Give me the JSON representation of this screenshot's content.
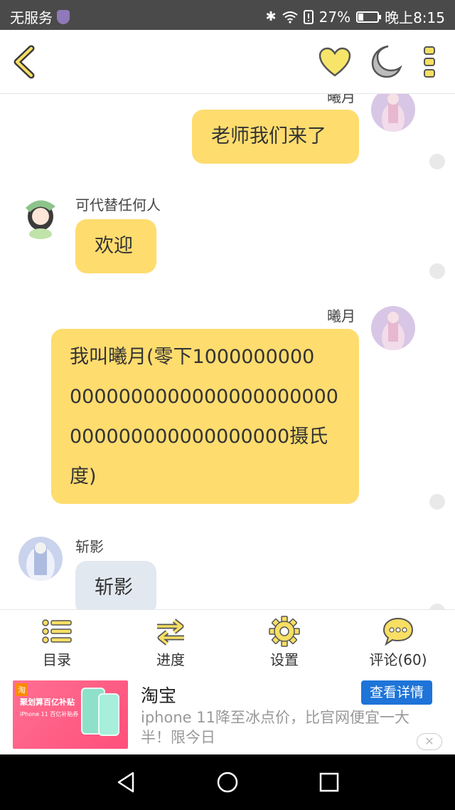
{
  "status_bar": {
    "carrier": "无服务",
    "battery": "27%",
    "battery_level": 0.27,
    "time": "晚上8:15"
  },
  "header": {
    "icons": [
      "back-icon",
      "heart-icon",
      "moon-icon",
      "more-icon"
    ],
    "accent": "#f7df63"
  },
  "messages": [
    {
      "side": "right",
      "sender": "曦月",
      "text": "老师我们来了",
      "bubble_color": "#fedc6e"
    },
    {
      "side": "left",
      "sender": "可代替任何人",
      "text": "欢迎",
      "bubble_color": "#fedc6e"
    },
    {
      "side": "right",
      "sender": "曦月",
      "lines": [
        "我叫曦月(零下1000000000",
        "0000000000000000000000",
        "000000000000000000摄氏",
        "度)"
      ],
      "bubble_color": "#fedc6e"
    },
    {
      "side": "left",
      "sender": "斩影",
      "text": "斩影",
      "bubble_color": "#e2e8f0"
    }
  ],
  "tabbar": {
    "items": [
      {
        "label": "目录",
        "icon": "list-icon"
      },
      {
        "label": "进度",
        "icon": "swap-icon"
      },
      {
        "label": "设置",
        "icon": "gear-icon"
      },
      {
        "label": "评论(60)",
        "icon": "comment-icon"
      }
    ]
  },
  "ad": {
    "title": "淘宝",
    "description": "iphone 11降至冰点价，比官网便宜一大半！限今日",
    "button": "查看详情",
    "image_caption": "聚划算百亿补贴",
    "image_sub": "iPhone 11 百亿补贴券",
    "image_badge": "淘",
    "close": "✕"
  },
  "nav": {
    "icons": [
      "nav-back-icon",
      "nav-home-icon",
      "nav-recent-icon"
    ]
  }
}
